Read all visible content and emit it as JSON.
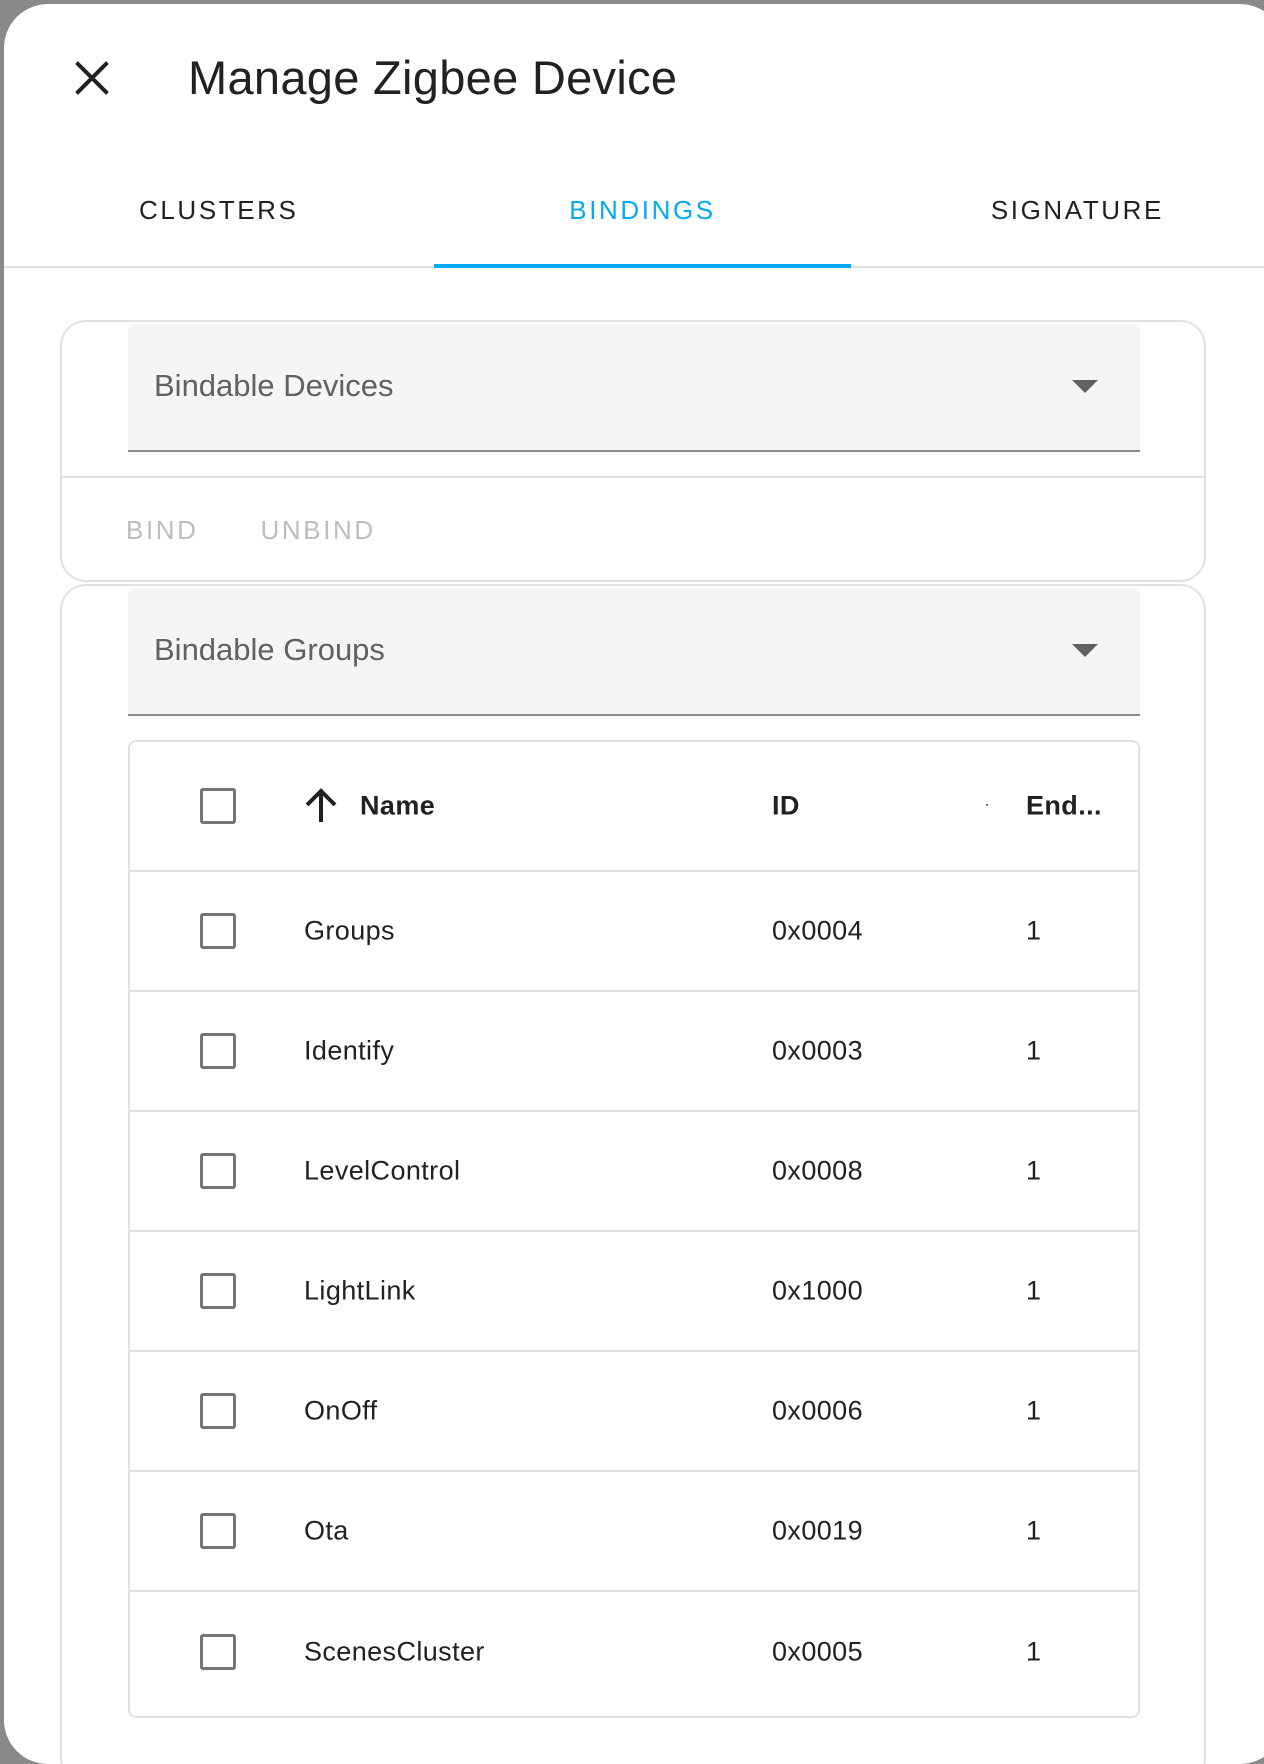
{
  "dialog": {
    "title": "Manage Zigbee Device",
    "close_icon": "close-icon"
  },
  "tabs": [
    {
      "label": "CLUSTERS",
      "active": false
    },
    {
      "label": "BINDINGS",
      "active": true
    },
    {
      "label": "SIGNATURE",
      "active": false
    }
  ],
  "devices_card": {
    "select_label": "Bindable Devices",
    "bind_label": "BIND",
    "unbind_label": "UNBIND"
  },
  "groups_card": {
    "select_label": "Bindable Groups",
    "table": {
      "columns": {
        "name": "Name",
        "id": "ID",
        "endpoint": "End..."
      },
      "sort_icon": "arrow-up-icon",
      "rows": [
        {
          "name": "Groups",
          "id": "0x0004",
          "endpoint": "1"
        },
        {
          "name": "Identify",
          "id": "0x0003",
          "endpoint": "1"
        },
        {
          "name": "LevelControl",
          "id": "0x0008",
          "endpoint": "1"
        },
        {
          "name": "LightLink",
          "id": "0x1000",
          "endpoint": "1"
        },
        {
          "name": "OnOff",
          "id": "0x0006",
          "endpoint": "1"
        },
        {
          "name": "Ota",
          "id": "0x0019",
          "endpoint": "1"
        },
        {
          "name": "ScenesCluster",
          "id": "0x0005",
          "endpoint": "1"
        }
      ]
    }
  },
  "colors": {
    "accent": "#03a9f4",
    "text": "#212121",
    "disabled": "#bdbdbd",
    "divider": "#e0e0e0"
  }
}
